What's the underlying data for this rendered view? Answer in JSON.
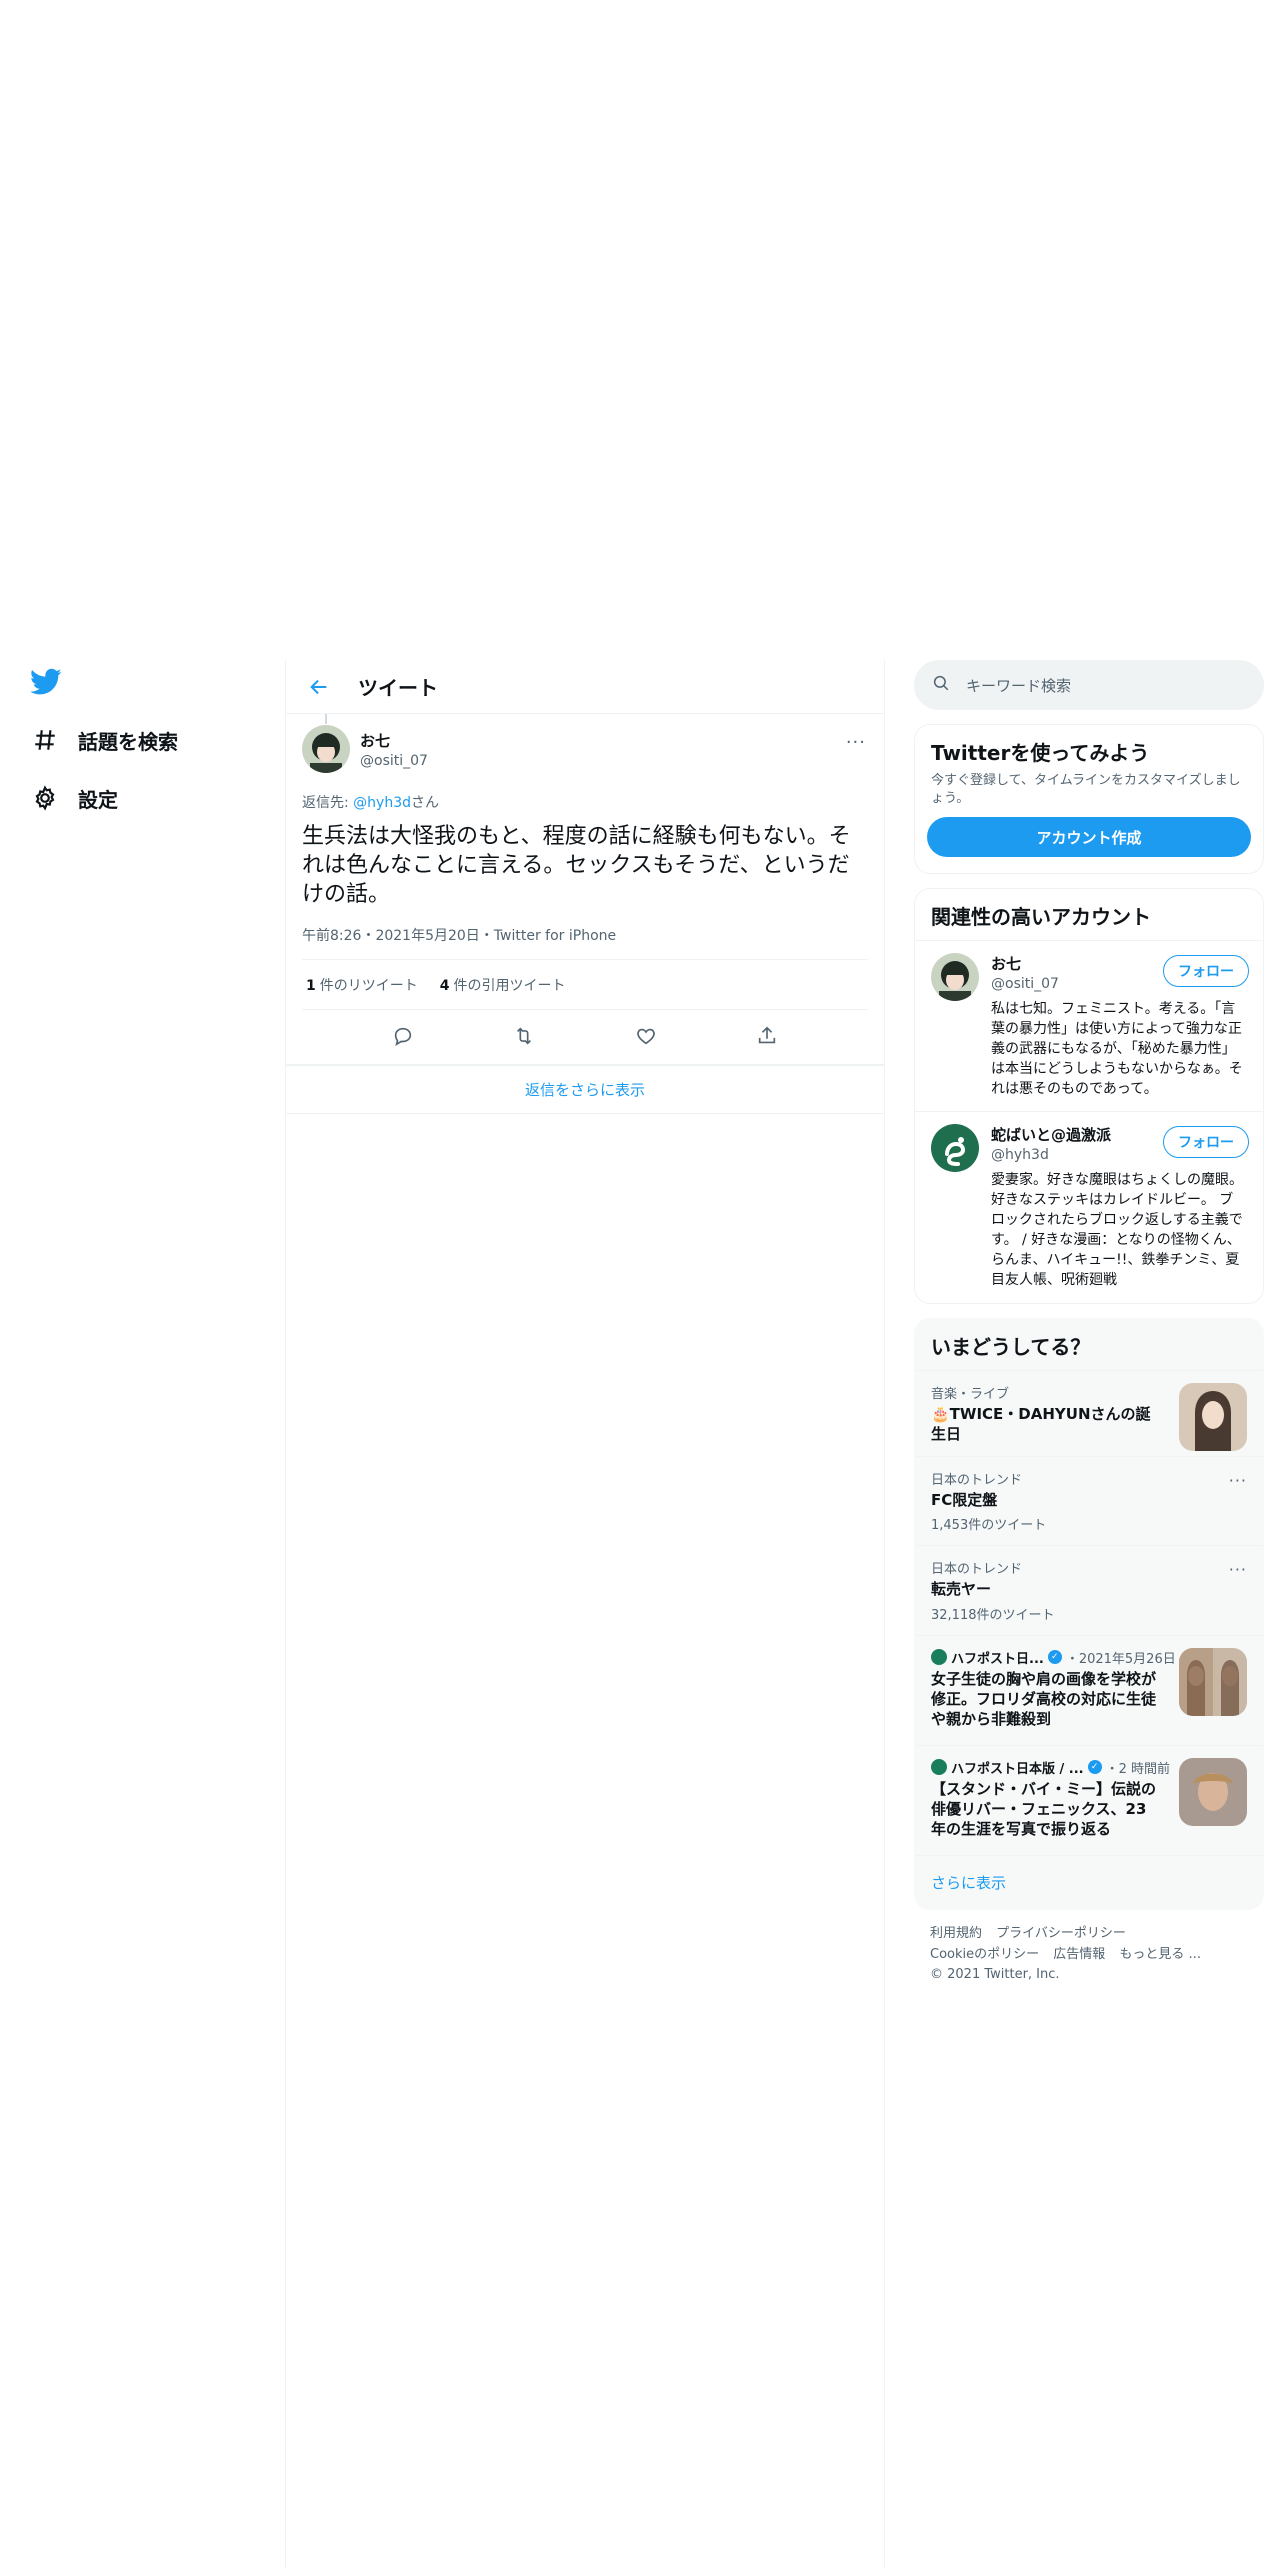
{
  "nav": {
    "explore_label": "話題を検索",
    "settings_label": "設定"
  },
  "main": {
    "title": "ツイート",
    "tweet": {
      "author_name": "お七",
      "author_handle": "@ositi_07",
      "reply_prefix": "返信先: ",
      "reply_handle": "@hyh3d",
      "reply_suffix": "さん",
      "text": "生兵法は大怪我のもと、程度の話に経験も何もない。それは色んなことに言える。セックスもそうだ、というだけの話。",
      "meta": "午前8:26・2021年5月20日・Twitter for iPhone",
      "retweet_count": "1",
      "retweet_label": "件のリツイート",
      "quote_count": "4",
      "quote_label": "件の引用ツイート"
    },
    "show_more_replies": "返信をさらに表示"
  },
  "right": {
    "search_placeholder": "キーワード検索",
    "signup": {
      "title": "Twitterを使ってみよう",
      "desc": "今すぐ登録して、タイムラインをカスタマイズしましょう。",
      "button": "アカウント作成"
    },
    "related": {
      "title": "関連性の高いアカウント",
      "follow_label": "フォロー",
      "accounts": [
        {
          "name": "お七",
          "handle": "@ositi_07",
          "bio": "私は七知。フェミニスト。考える。「言葉の暴力性」は使い方によって強力な正義の武器にもなるが、「秘めた暴力性」は本当にどうしようもないからなぁ。それは悪そのものであって。"
        },
        {
          "name": "蛇ばいと@過激派",
          "handle": "@hyh3d",
          "bio": "愛妻家。好きな魔眼はちょくしの魔眼。好きなステッキはカレイドルビー。 ブロックされたらブロック返しする主義です。 / 好きな漫画：となりの怪物くん、らんま、ハイキュー!!、鉄拳チンミ、夏目友人帳、呪術廻戦"
        }
      ]
    },
    "trends": {
      "title": "いまどうしてる？",
      "items": [
        {
          "category": "音楽・ライブ",
          "title": "🎂TWICE・DAHYUNさんの誕生日"
        },
        {
          "category": "日本のトレンド",
          "title": "FC限定盤",
          "count": "1,453件のツイート"
        },
        {
          "category": "日本のトレンド",
          "title": "転売ヤー",
          "count": "32,118件のツイート"
        },
        {
          "source": "ハフポスト日...",
          "time": "・2021年5月26日",
          "title": "女子生徒の胸や肩の画像を学校が修正。フロリダ高校の対応に生徒や親から非難殺到"
        },
        {
          "source": "ハフポスト日本版 / ...",
          "time": "・2 時間前",
          "title": "【スタンド・バイ・ミー】伝説の俳優リバー・フェニックス、23年の生涯を写真で振り返る"
        }
      ],
      "show_more": "さらに表示"
    },
    "footer": {
      "links_row1": [
        "利用規約",
        "プライバシーポリシー"
      ],
      "links_row2": [
        "Cookieのポリシー",
        "広告情報",
        "もっと見る ..."
      ],
      "copyright": "© 2021 Twitter, Inc."
    }
  },
  "colors": {
    "accent": "#1d9bf0",
    "text": "#0f1419",
    "secondary": "#536471",
    "border": "#eff3f4"
  }
}
